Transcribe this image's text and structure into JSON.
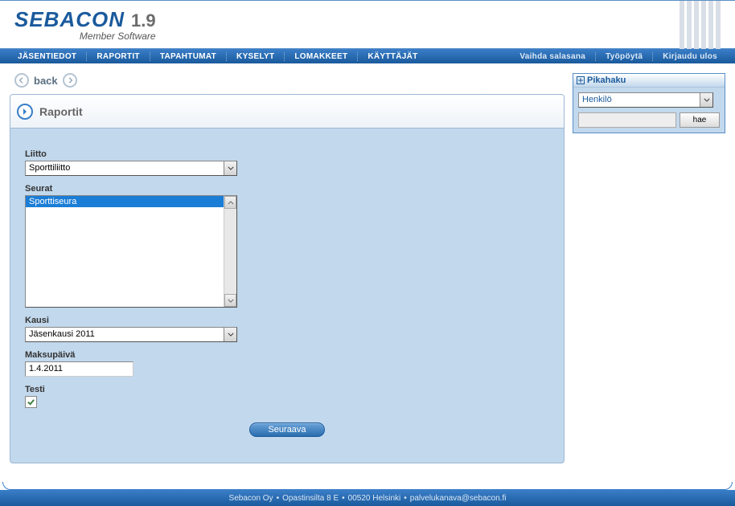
{
  "logo": {
    "name": "SEBACON",
    "version": "1.9",
    "sub": "Member Software"
  },
  "nav": {
    "left": [
      "JÄSENTIEDOT",
      "RAPORTIT",
      "TAPAHTUMAT",
      "KYSELYT",
      "LOMAKKEET",
      "KÄYTTÄJÄT"
    ],
    "right": [
      "Vaihda salasana",
      "Työpöytä",
      "Kirjaudu ulos"
    ]
  },
  "back_label": "back",
  "panel": {
    "title": "Raportit"
  },
  "form": {
    "liitto": {
      "label": "Liitto",
      "value": "Sporttiliitto"
    },
    "seurat": {
      "label": "Seurat",
      "items": [
        "Sporttiseura"
      ]
    },
    "kausi": {
      "label": "Kausi",
      "value": "Jäsenkausi 2011"
    },
    "maksupaiva": {
      "label": "Maksupäivä",
      "value": "1.4.2011"
    },
    "testi": {
      "label": "Testi",
      "checked": true
    },
    "submit": "Seuraava"
  },
  "sidebox": {
    "title": "Pikahaku",
    "select": "Henkilö",
    "button": "hae"
  },
  "footer": {
    "company": "Sebacon Oy",
    "address": "Opastinsilta 8 E",
    "city": "00520 Helsinki",
    "email": "palvelukanava@sebacon.fi"
  }
}
